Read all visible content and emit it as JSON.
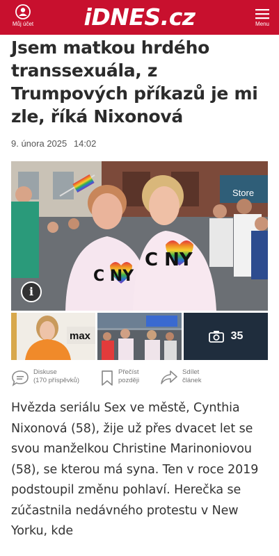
{
  "header": {
    "logo": "iDNES.cz",
    "account_label": "Můj účet",
    "menu_label": "Menu",
    "brand_color": "#c8102e"
  },
  "article": {
    "title": "Jsem matkou hrdého transsexuála, z Trumpových příkazů je mi zle, říká Nixonová",
    "date": "9. února 2025",
    "time": "14:02",
    "photo_icons": {
      "info": "info-icon"
    },
    "thumbnails": {
      "thumb2_logo_text": "max",
      "gallery_count": "35",
      "gallery_icon": "camera-icon"
    },
    "actions": {
      "discuss_label": "Diskuse",
      "discuss_count": "(170 příspěvků)",
      "read_later_line1": "Přečíst",
      "read_later_line2": "později",
      "share_line1": "Sdílet",
      "share_line2": "článek"
    },
    "lead_text": "Hvězda seriálu Sex ve městě, Cynthia Nixonová (58), žije už přes dvacet let se svou manželkou Christine Marinoniovou (58), se kterou má syna. Ten v roce 2019 podstoupil změnu pohlaví. Herečka se zúčastnila nedávného protestu v New Yorku, kde",
    "photo_text": {
      "shirt_letters_left": "C NY",
      "shirt_letters_right": "C NY",
      "store_sign": "Store"
    }
  }
}
